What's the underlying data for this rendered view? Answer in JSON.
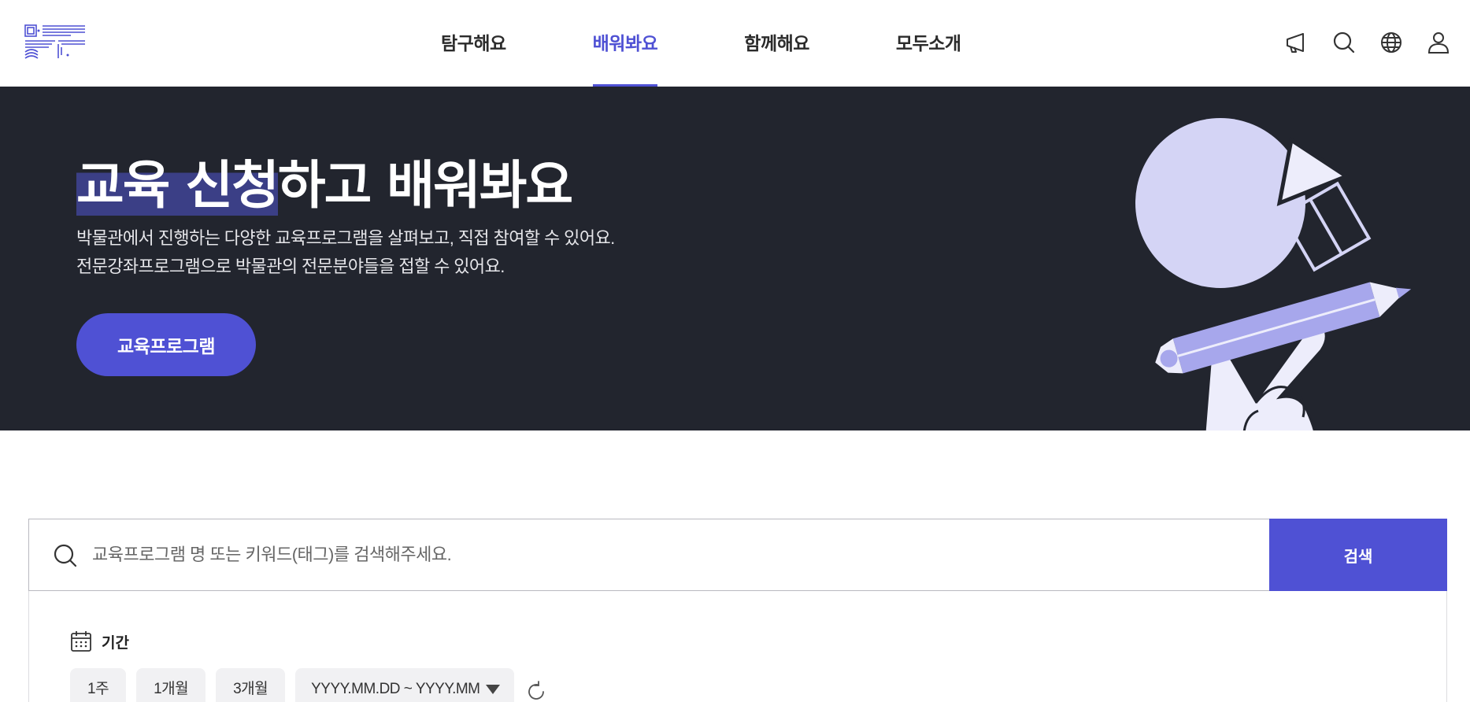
{
  "header": {
    "nav": [
      {
        "label": "탐구해요",
        "active": false
      },
      {
        "label": "배워봐요",
        "active": true
      },
      {
        "label": "함께해요",
        "active": false
      },
      {
        "label": "모두소개",
        "active": false
      }
    ],
    "utility_icons": [
      "megaphone-icon",
      "search-icon",
      "globe-icon",
      "user-icon"
    ]
  },
  "hero": {
    "title_highlight": "교육 신청",
    "title_rest": "하고 배워봐요",
    "desc_line1": "박물관에서 진행하는 다양한 교육프로그램을 살펴보고, 직접 참여할 수 있어요.",
    "desc_line2": "전문강좌프로그램으로 박물관의 전문분야들을 접할 수 있어요.",
    "button_label": "교육프로그램"
  },
  "search": {
    "placeholder": "교육프로그램 명 또는 키워드(태그)를 검색해주세요.",
    "button_label": "검색"
  },
  "filter": {
    "label": "기간",
    "chips": [
      "1주",
      "1개월",
      "3개월"
    ],
    "date_range_value": "YYYY.MM.DD ~ YYYY.MM.DD"
  },
  "colors": {
    "accent": "#4f51d4",
    "hero_bg": "#22252e",
    "highlight": "#3b3f86",
    "illustration_light": "#d4d4f5"
  }
}
